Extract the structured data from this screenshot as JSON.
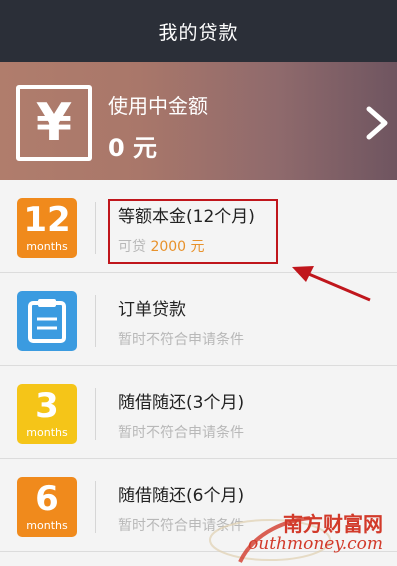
{
  "header": {
    "title": "我的贷款"
  },
  "banner": {
    "icon": "yen-icon",
    "icon_glyph": "¥",
    "label": "使用中金额",
    "amount": "0 元"
  },
  "loans": [
    {
      "badge_num": "12",
      "badge_unit": "months",
      "badge_color": "#f08a1c",
      "name": "等额本金(12个月)",
      "sub_prefix": "可贷",
      "sub_amount": "2000 元"
    },
    {
      "icon": "clipboard-icon",
      "badge_color": "#3b9be0",
      "name": "订单贷款",
      "sub": "暂时不符合申请条件"
    },
    {
      "badge_num": "3",
      "badge_unit": "months",
      "badge_color": "#f5c518",
      "name": "随借随还(3个月)",
      "sub": "暂时不符合申请条件"
    },
    {
      "badge_num": "6",
      "badge_unit": "months",
      "badge_color": "#f08a1c",
      "name": "随借随还(6个月)",
      "sub": "暂时不符合申请条件"
    }
  ],
  "watermark": {
    "cn": "南方财富网",
    "en": "outhmoney.com"
  },
  "colors": {
    "accent": "#e8922c",
    "highlight": "#c0161c",
    "header_bg": "#2b2f38"
  }
}
